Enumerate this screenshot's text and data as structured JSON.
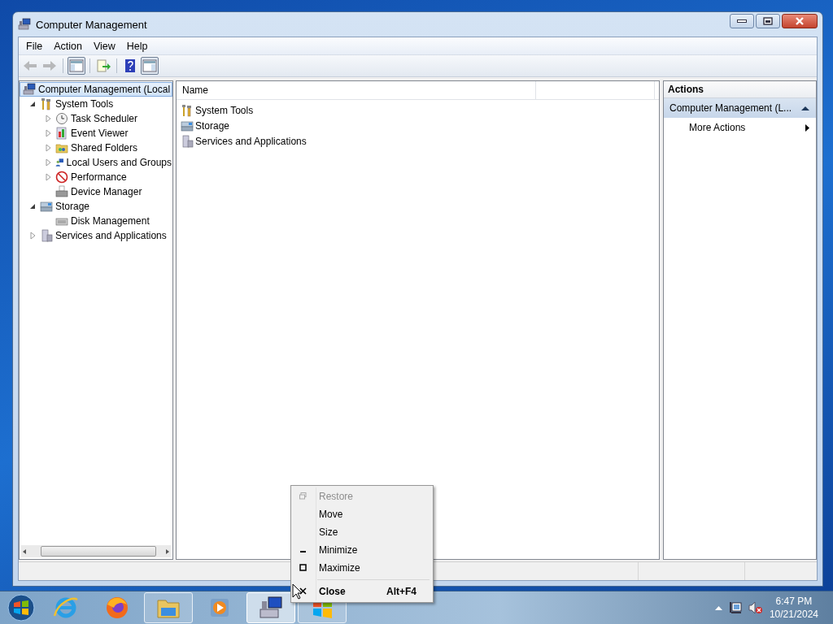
{
  "window": {
    "title": "Computer Management"
  },
  "menu": [
    {
      "label": "File"
    },
    {
      "label": "Action"
    },
    {
      "label": "View"
    },
    {
      "label": "Help"
    }
  ],
  "toolbar": [
    {
      "kind": "back",
      "disabled": true,
      "pressed": false
    },
    {
      "kind": "forward",
      "disabled": true,
      "pressed": false
    },
    {
      "kind": "tree-pane",
      "disabled": false,
      "pressed": true
    },
    {
      "kind": "export",
      "disabled": false,
      "pressed": false
    },
    {
      "kind": "help",
      "disabled": false,
      "pressed": false
    },
    {
      "kind": "action-pane",
      "disabled": false,
      "pressed": true
    }
  ],
  "tree": [
    {
      "label": "Computer Management (Local",
      "kind": "computer",
      "selected": true,
      "children": [
        {
          "label": "System Tools",
          "kind": "tools",
          "selected": false,
          "expanded": true,
          "children": [
            {
              "label": "Task Scheduler",
              "kind": "clock",
              "selected": false,
              "expanded": false
            },
            {
              "label": "Event Viewer",
              "kind": "log",
              "selected": false,
              "expanded": false
            },
            {
              "label": "Shared Folders",
              "kind": "share",
              "selected": false,
              "expanded": false
            },
            {
              "label": "Local Users and Groups",
              "kind": "users",
              "selected": false,
              "expanded": false
            },
            {
              "label": "Performance",
              "kind": "perf",
              "selected": false,
              "expanded": false
            },
            {
              "label": "Device Manager",
              "kind": "device",
              "selected": false
            }
          ]
        },
        {
          "label": "Storage",
          "kind": "storage",
          "selected": false,
          "expanded": true,
          "children": [
            {
              "label": "Disk Management",
              "kind": "disk",
              "selected": false
            }
          ]
        },
        {
          "label": "Services and Applications",
          "kind": "services",
          "selected": false,
          "expanded": false
        }
      ]
    }
  ],
  "list": {
    "columns": [
      {
        "label": "Name"
      }
    ],
    "rows": [
      {
        "label": "System Tools",
        "kind": "tools"
      },
      {
        "label": "Storage",
        "kind": "storage"
      },
      {
        "label": "Services and Applications",
        "kind": "services"
      }
    ]
  },
  "actions": {
    "title": "Actions",
    "sections": [
      {
        "label": "Computer Management (L...",
        "expanded": true,
        "items": [
          {
            "label": "More Actions",
            "submenu": true
          }
        ]
      }
    ]
  },
  "context_menu": {
    "items": [
      {
        "kind": "restore",
        "label": "Restore",
        "disabled": true,
        "default": false
      },
      {
        "kind": "plain",
        "label": "Move",
        "disabled": false,
        "default": false
      },
      {
        "kind": "plain",
        "label": "Size",
        "disabled": false,
        "default": false
      },
      {
        "kind": "minimize",
        "label": "Minimize",
        "disabled": false,
        "default": false
      },
      {
        "kind": "maximize",
        "label": "Maximize",
        "disabled": false,
        "default": false
      },
      {
        "kind": "separator"
      },
      {
        "kind": "close",
        "label": "Close",
        "shortcut": "Alt+F4",
        "disabled": false,
        "default": true
      }
    ]
  },
  "taskbar": {
    "buttons": [
      {
        "kind": "ie",
        "running": false,
        "selected": false
      },
      {
        "kind": "firefox",
        "running": false,
        "selected": false
      },
      {
        "kind": "explorer",
        "running": true,
        "selected": false
      },
      {
        "kind": "media",
        "running": false,
        "selected": false
      },
      {
        "kind": "computer",
        "running": true,
        "selected": true
      },
      {
        "kind": "windows",
        "running": true,
        "selected": false
      }
    ],
    "tray": {
      "time": "6:47 PM",
      "date": "10/21/2024"
    }
  }
}
